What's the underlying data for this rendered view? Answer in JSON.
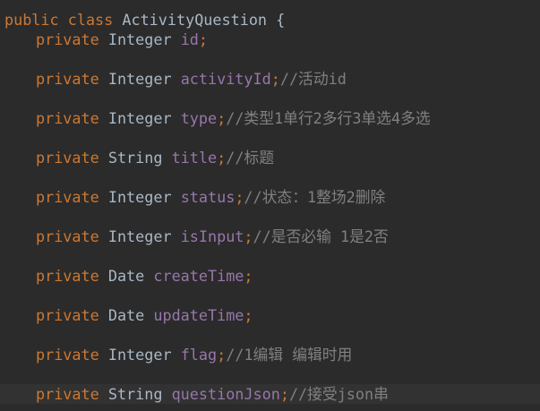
{
  "editor": {
    "class_decl": {
      "modifier": "public",
      "keyword": "class",
      "name": "ActivityQuestion",
      "brace": "{"
    },
    "fields": [
      {
        "modifier": "private",
        "type": "Integer",
        "name": "id",
        "semi": ";",
        "comment": ""
      },
      {
        "modifier": "private",
        "type": "Integer",
        "name": "activityId",
        "semi": ";",
        "comment": "//活动id"
      },
      {
        "modifier": "private",
        "type": "Integer",
        "name": "type",
        "semi": ";",
        "comment": "//类型1单行2多行3单选4多选"
      },
      {
        "modifier": "private",
        "type": "String",
        "name": "title",
        "semi": ";",
        "comment": "//标题"
      },
      {
        "modifier": "private",
        "type": "Integer",
        "name": "status",
        "semi": ";",
        "comment": "//状态：1整场2删除"
      },
      {
        "modifier": "private",
        "type": "Integer",
        "name": "isInput",
        "semi": ";",
        "comment": "//是否必输 1是2否"
      },
      {
        "modifier": "private",
        "type": "Date",
        "name": "createTime",
        "semi": ";",
        "comment": ""
      },
      {
        "modifier": "private",
        "type": "Date",
        "name": "updateTime",
        "semi": ";",
        "comment": ""
      },
      {
        "modifier": "private",
        "type": "Integer",
        "name": "flag",
        "semi": ";",
        "comment": "//1编辑 编辑时用"
      },
      {
        "modifier": "private",
        "type": "String",
        "name": "questionJson",
        "semi": ";",
        "comment": "//接受json串"
      }
    ],
    "colors": {
      "background": "#2b2b2b",
      "keyword": "#cc7832",
      "field": "#9876aa",
      "comment": "#808080",
      "text": "#a9b7c6",
      "current_line": "#323232"
    }
  }
}
